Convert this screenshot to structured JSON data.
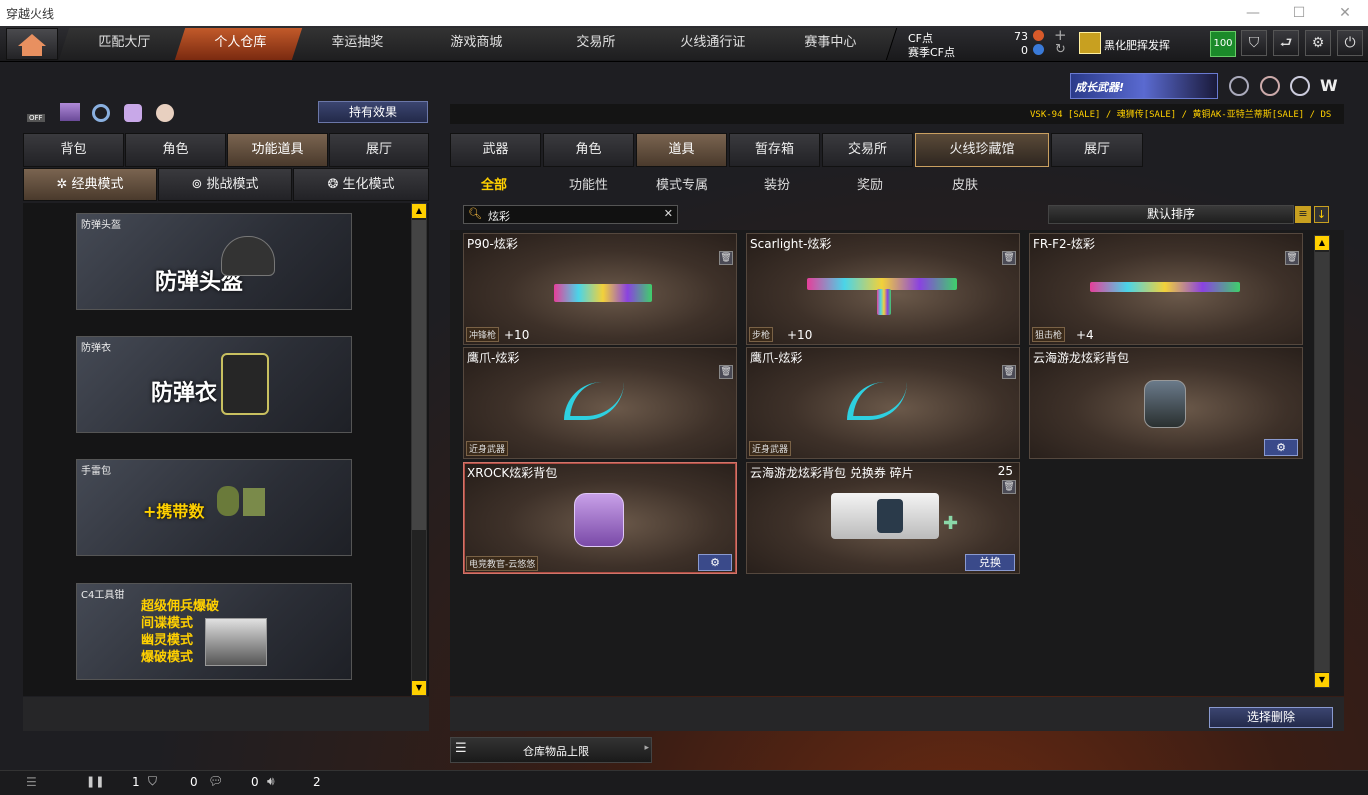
{
  "window": {
    "title": "穿越火线"
  },
  "nav": {
    "tabs": [
      "匹配大厅",
      "个人仓库",
      "幸运抽奖",
      "游戏商城",
      "交易所",
      "火线通行证",
      "赛事中心"
    ],
    "active": 1
  },
  "currency": {
    "cf_label": "CF点",
    "cf_value": "73",
    "match_label": "赛季CF点",
    "match_value": "0"
  },
  "user": {
    "name": "黑化肥挥发挥",
    "level": "100"
  },
  "banner": {
    "text": "成长武器!"
  },
  "ticker": "VSK-94 [SALE] / 魂狮传[SALE] / 黄铜AK-亚特兰蒂斯[SALE] / DS",
  "left": {
    "effects_button": "持有效果",
    "toggle_off": "OFF",
    "tabs": [
      "背包",
      "角色",
      "功能道具",
      "展厅"
    ],
    "active_tab": 2,
    "modes": [
      "经典模式",
      "挑战模式",
      "生化模式"
    ],
    "active_mode": 0,
    "items": [
      {
        "label": "防弹头盔",
        "title": "防弹头盔"
      },
      {
        "label": "防弹衣",
        "title": "防弹衣"
      },
      {
        "label": "手雷包",
        "title": "+携带数"
      },
      {
        "label": "C4工具钳",
        "lines": [
          "超级佣兵爆破",
          "间谍模式",
          "幽灵模式",
          "爆破模式"
        ]
      }
    ]
  },
  "right": {
    "tabs": [
      "武器",
      "角色",
      "道具",
      "暂存箱",
      "交易所",
      "火线珍藏馆",
      "展厅"
    ],
    "active_tab": 2,
    "highlight_tab": 5,
    "subtabs": [
      "全部",
      "功能性",
      "模式专属",
      "装扮",
      "奖励",
      "皮肤"
    ],
    "active_subtab": 0,
    "search_value": "炫彩",
    "sort_label": "默认排序",
    "cards": [
      {
        "name": "P90-炫彩",
        "tag": "冲锋枪",
        "level": "+10"
      },
      {
        "name": "Scarlight-炫彩",
        "tag": "步枪",
        "level": "+10"
      },
      {
        "name": "FR-F2-炫彩",
        "tag": "狙击枪",
        "level": "+4"
      },
      {
        "name": "鹰爪-炫彩",
        "tag": "近身武器"
      },
      {
        "name": "鹰爪-炫彩",
        "tag": "近身武器"
      },
      {
        "name": "云海游龙炫彩背包"
      },
      {
        "name": "XROCK炫彩背包",
        "tag": "电竞教官-云悠悠"
      },
      {
        "name": "云海游龙炫彩背包 兑换券 碎片",
        "count": "25",
        "action": "兑换"
      }
    ],
    "delete_button": "选择删除",
    "storage_label": "仓库物品上限"
  },
  "status": {
    "v1": "1",
    "v2": "0",
    "v3": "0",
    "v4": "2"
  },
  "colors": {
    "accent": "#c25a2a",
    "highlight": "#ffd000",
    "blue_btn": "#3a4a8a"
  }
}
